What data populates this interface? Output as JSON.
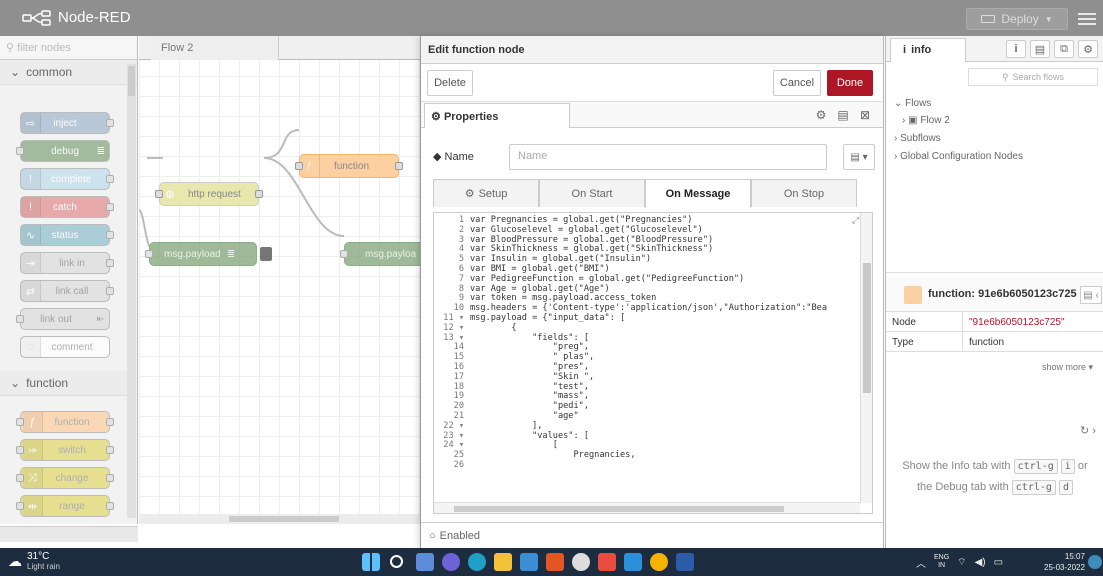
{
  "header": {
    "app_title": "Node-RED",
    "deploy_label": "Deploy"
  },
  "palette": {
    "filter_placeholder": "filter nodes",
    "categories": [
      "common",
      "function"
    ],
    "common_nodes": [
      "inject",
      "debug",
      "complete",
      "catch",
      "status",
      "link in",
      "link call",
      "link out",
      "comment"
    ],
    "function_nodes": [
      "function",
      "switch",
      "change",
      "range"
    ]
  },
  "workspace": {
    "flow_tab": "Flow 2",
    "nodes": {
      "function": "function",
      "http_request": "http request",
      "msg_payload_debug": "msg.payload",
      "msg_payload_2": "msg.payloa"
    }
  },
  "tray": {
    "title": "Edit function node",
    "delete_label": "Delete",
    "cancel_label": "Cancel",
    "done_label": "Done",
    "properties_tab": "Properties",
    "name_label": "Name",
    "name_placeholder": "Name",
    "tabs": [
      "Setup",
      "On Start",
      "On Message",
      "On Stop"
    ],
    "active_tab": "On Message",
    "enabled_label": "Enabled",
    "code_lines": [
      {
        "n": "1",
        "t": "var Pregnancies = global.get(\"Pregnancies\")"
      },
      {
        "n": "2",
        "t": "var Glucoselevel = global.get(\"Glucoselevel\")"
      },
      {
        "n": "3",
        "t": "var BloodPressure = global.get(\"BloodPressure\")"
      },
      {
        "n": "4",
        "t": "var SkinThickness = global.get(\"SkinThickness\")"
      },
      {
        "n": "5",
        "t": "var Insulin = global.get(\"Insulin\")"
      },
      {
        "n": "6",
        "t": "var BMI = global.get(\"BMI\")"
      },
      {
        "n": "7",
        "t": "var PedigreeFunction = global.get(\"PedigreeFunction\")"
      },
      {
        "n": "8",
        "t": "var Age = global.get(\"Age\")"
      },
      {
        "n": "9",
        "t": "var token = msg.payload.access_token"
      },
      {
        "n": "10",
        "t": "msg.headers = {'Content-type':'application/json',\"Authorization\":\"Bea"
      },
      {
        "n": "11 ▾",
        "t": "msg.payload = {\"input_data\": ["
      },
      {
        "n": "12 ▾",
        "t": "        {"
      },
      {
        "n": "13 ▾",
        "t": "            \"fields\": ["
      },
      {
        "n": "14",
        "t": "                \"preg\","
      },
      {
        "n": "15",
        "t": "                \" plas\","
      },
      {
        "n": "16",
        "t": "                \"pres\","
      },
      {
        "n": "17",
        "t": "                \"Skin \","
      },
      {
        "n": "18",
        "t": "                \"test\","
      },
      {
        "n": "19",
        "t": "                \"mass\","
      },
      {
        "n": "20",
        "t": "                \"pedi\","
      },
      {
        "n": "21",
        "t": "                \"age\""
      },
      {
        "n": "22 ▾",
        "t": "            ],"
      },
      {
        "n": "23 ▾",
        "t": "            \"values\": ["
      },
      {
        "n": "24 ▾",
        "t": "                ["
      },
      {
        "n": "25",
        "t": "                    Pregnancies,"
      },
      {
        "n": "26",
        "t": ""
      }
    ]
  },
  "sidebar": {
    "info_tab": "info",
    "search_placeholder": "Search flows",
    "tree": {
      "flows": "Flows",
      "flow2": "Flow 2",
      "subflows": "Subflows",
      "global_config": "Global Configuration Nodes"
    },
    "node_title": "function: 91e6b6050123c725",
    "props": [
      {
        "key": "Node",
        "value": "\"91e6b6050123c725\""
      },
      {
        "key": "Type",
        "value": "function"
      }
    ],
    "show_more": "show more ▾",
    "help_line1": "Show the Info tab with",
    "help_line2": "the Debug tab with",
    "kbd_ctrl": "ctrl-g",
    "kbd_i": "i",
    "kbd_d": "d",
    "or_text": "or"
  },
  "taskbar": {
    "temp": "31°C",
    "weather": "Light rain",
    "lang_top": "ENG",
    "lang_bottom": "IN",
    "time": "15:07",
    "date": "25-03-2022"
  },
  "colors": {
    "header": "#8f8f8f",
    "done": "#ad1625",
    "taskbar": "#1d2d3f",
    "function_node": "#fdd0a2",
    "debug_node": "#87a980",
    "catch_node": "#e49191",
    "inject_node": "#a6bbcf",
    "link_node": "#dddddd",
    "switch_node": "#e2d96e"
  }
}
